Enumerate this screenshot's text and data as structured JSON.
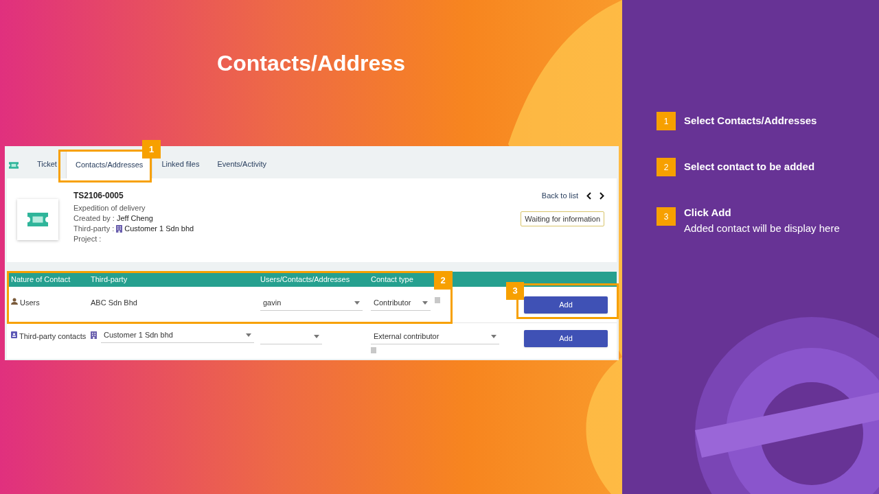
{
  "slide_title": "Contacts/Address",
  "tabs": [
    {
      "label": "Ticket",
      "selected": false
    },
    {
      "label": "Contacts/Addresses",
      "selected": true
    },
    {
      "label": "Linked files",
      "selected": false
    },
    {
      "label": "Events/Activity",
      "selected": false
    }
  ],
  "ticket": {
    "ref": "TS2106-0005",
    "subject": "Expedition of delivery",
    "created_by_label": "Created by :",
    "created_by": "Jeff Cheng",
    "third_party_label": "Third-party :",
    "third_party": "Customer 1 Sdn bhd",
    "project_label": "Project :",
    "back_link": "Back to list",
    "status": "Waiting for information"
  },
  "table": {
    "columns": [
      "Nature of Contact",
      "Third-party",
      "Users/Contacts/Addresses",
      "Contact type"
    ],
    "rows": [
      {
        "kind": "users",
        "nature": "Users",
        "third_party": {
          "kind": "text",
          "value": "ABC Sdn Bhd"
        },
        "contact": "gavin",
        "contact_type": "Contributor",
        "button": "Add"
      },
      {
        "kind": "third-party",
        "nature": "Third-party contacts",
        "third_party": {
          "kind": "select",
          "value": "Customer 1 Sdn bhd"
        },
        "contact": "",
        "contact_type": "External contributor",
        "button": "Add"
      }
    ]
  },
  "callouts": [
    "1",
    "2",
    "3"
  ],
  "steps": [
    {
      "number": "1",
      "title": "Select Contacts/Addresses"
    },
    {
      "number": "2",
      "title": "Select contact to be added"
    },
    {
      "number": "3",
      "title": "Click Add",
      "description": "Added contact will be display here"
    }
  ]
}
